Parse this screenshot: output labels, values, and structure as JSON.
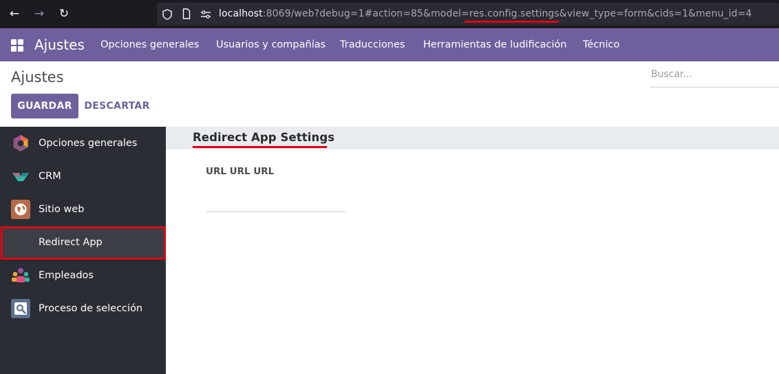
{
  "browser": {
    "back_glyph": "←",
    "forward_glyph": "→",
    "reload_glyph": "↻",
    "url_host": "localhost",
    "url_rest": ":8069/web?debug=1#action=85&model=res.config.settings&view_type=form&cids=1&menu_id=4"
  },
  "topnav": {
    "brand": "Ajustes",
    "menu": [
      {
        "label": "Opciones generales"
      },
      {
        "label": "Usuarios y compañías"
      },
      {
        "label": "Traducciones"
      },
      {
        "label": "Herramientas de ludificación"
      },
      {
        "label": "Técnico"
      }
    ]
  },
  "control_panel": {
    "title": "Ajustes",
    "search_placeholder": "Buscar...",
    "save_label": "GUARDAR",
    "discard_label": "DESCARTAR"
  },
  "sidebar": {
    "items": [
      {
        "label": "Opciones generales",
        "icon": "settings-hexagon-icon"
      },
      {
        "label": "CRM",
        "icon": "crm-handshake-icon"
      },
      {
        "label": "Sitio web",
        "icon": "globe-icon"
      },
      {
        "label": "Redirect App",
        "icon": "",
        "active": true
      },
      {
        "label": "Empleados",
        "icon": "employees-icon"
      },
      {
        "label": "Proceso de selección",
        "icon": "recruitment-search-icon"
      }
    ]
  },
  "main": {
    "section_title": "Redirect App Settings",
    "field_label": "URL URL URL",
    "field_value": ""
  },
  "colors": {
    "brand": "#6f609d",
    "sidebar_bg": "#2a2d33",
    "highlight": "#e0000f"
  }
}
